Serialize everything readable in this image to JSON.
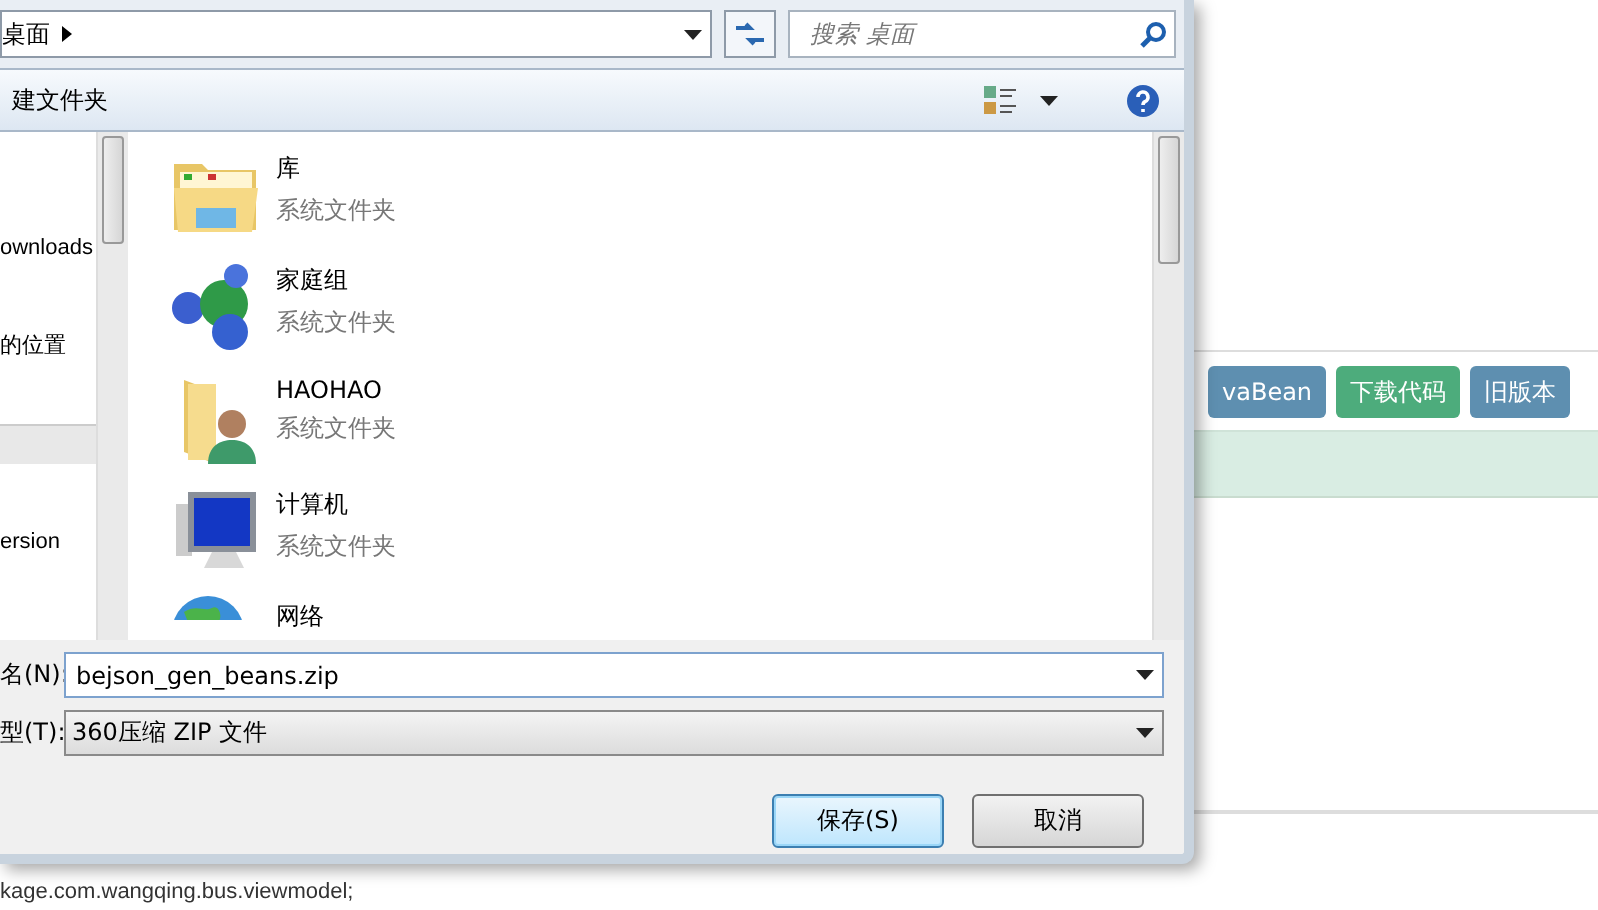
{
  "dialog": {
    "address": {
      "path": "桌面"
    },
    "search": {
      "placeholder": "搜索 桌面"
    },
    "toolbar": {
      "new_folder": "建文件夹"
    },
    "nav": [
      {
        "kind": "item",
        "label": "ownloads"
      },
      {
        "kind": "item",
        "label": "的位置"
      },
      {
        "kind": "group"
      },
      {
        "kind": "item",
        "label": "ersion"
      }
    ],
    "items": [
      {
        "kind": "library",
        "name": "库",
        "type": "系统文件夹"
      },
      {
        "kind": "homegroup",
        "name": "家庭组",
        "type": "系统文件夹"
      },
      {
        "kind": "user",
        "name": "HAOHAO",
        "type": "系统文件夹"
      },
      {
        "kind": "computer",
        "name": "计算机",
        "type": "系统文件夹"
      },
      {
        "kind": "network",
        "name": "网络"
      }
    ],
    "filename": {
      "label": "名(N):",
      "value": "bejson_gen_beans.zip"
    },
    "filetype": {
      "label": "型(T):",
      "value": "360压缩 ZIP 文件"
    },
    "buttons": [
      {
        "label": "保存(S)",
        "default": true
      },
      {
        "label": "取消",
        "default": false
      }
    ]
  },
  "page": {
    "buttons": [
      {
        "label": "vaBean",
        "color": "#5e8fb0"
      },
      {
        "label": "下载代码",
        "color": "#4dac7c"
      },
      {
        "label": "旧版本",
        "color": "#5e8fb0"
      }
    ],
    "code_line": "kage.com.wangqing.bus.viewmodel;"
  }
}
